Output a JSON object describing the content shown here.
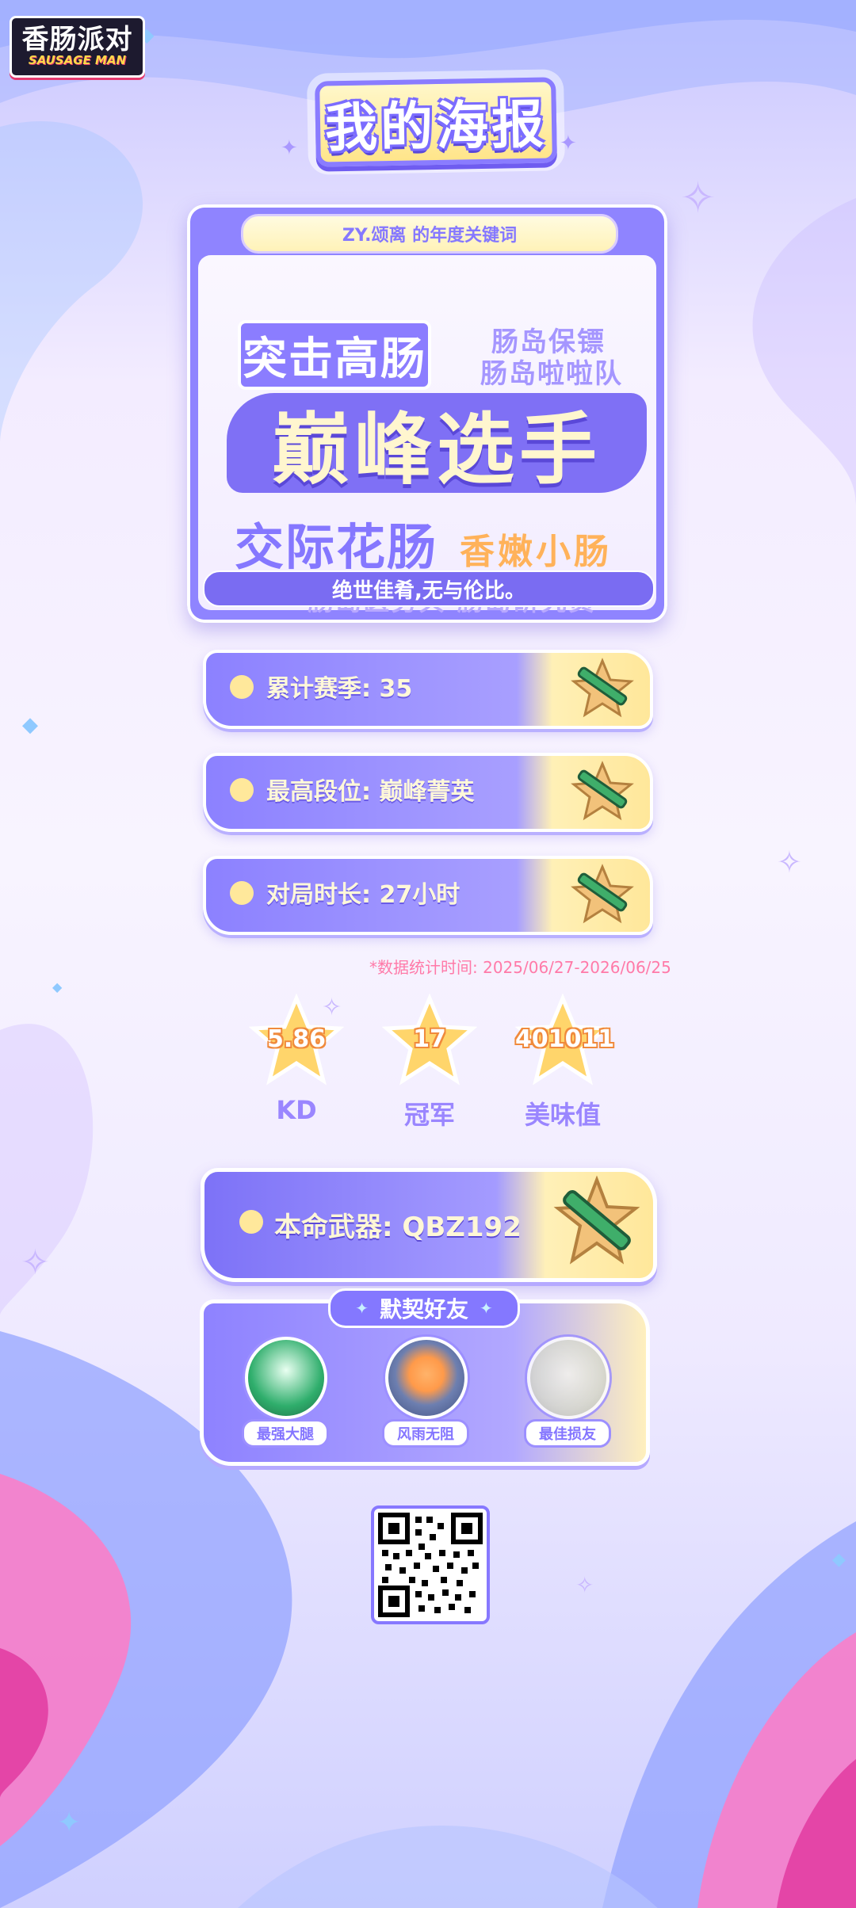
{
  "logo": {
    "line1": "香肠派对",
    "line2": "SAUSAGE MAN"
  },
  "page_title": "我的海报",
  "keywords": {
    "header": "ZY.颂离  的年度关键词",
    "tag_primary": "突击高肠",
    "side_1": "肠岛保镖",
    "side_2": "肠岛啦啦队",
    "main": "巅峰选手",
    "row3_left": "交际花肠",
    "row3_right": "香嫩小肠",
    "row4": "肠岛医务兵  肠岛研究员",
    "footer": "绝世佳肴,无与伦比。"
  },
  "stats": [
    {
      "label": "累计赛季: 35"
    },
    {
      "label": "最高段位: 巅峰菁英"
    },
    {
      "label": "对局时长: 27小时"
    }
  ],
  "data_note": "*数据统计时间: 2025/06/27-2026/06/25",
  "highlights": [
    {
      "value": "5.86",
      "label": "KD"
    },
    {
      "value": "17",
      "label": "冠军"
    },
    {
      "value": "401011",
      "label": "美味值"
    }
  ],
  "weapon": {
    "label": "本命武器: QBZ192"
  },
  "friends": {
    "title": "默契好友",
    "items": [
      {
        "label": "最强大腿"
      },
      {
        "label": "风雨无阻"
      },
      {
        "label": "最佳损友"
      }
    ]
  },
  "colors": {
    "accent": "#8b7dff",
    "highlight_yellow": "#ffe79a",
    "note_pink": "#ff7aa8",
    "star_orange": "#f08a3c"
  },
  "icons": [
    "rifle-star-icon",
    "sparkle-icon",
    "crystal-icon",
    "qr-code-icon"
  ]
}
